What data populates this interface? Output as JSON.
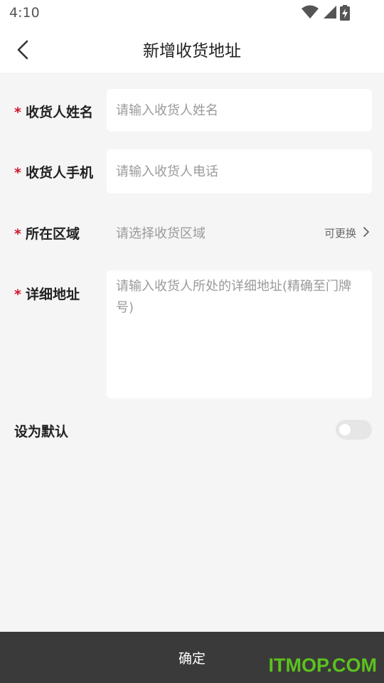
{
  "status_bar": {
    "time": "4:10",
    "icons": [
      "wifi-icon",
      "cellular-signal-icon",
      "battery-charging-icon"
    ]
  },
  "header": {
    "title": "新增收货地址",
    "back_icon": "chevron-left-icon"
  },
  "form": {
    "required_mark": "*",
    "name": {
      "label": "收货人姓名",
      "placeholder": "请输入收货人姓名",
      "value": ""
    },
    "phone": {
      "label": "收货人手机",
      "placeholder": "请输入收货人电话",
      "value": ""
    },
    "region": {
      "label": "所在区域",
      "placeholder": "请选择收货区域",
      "change_label": "可更换",
      "chevron_icon": "chevron-right-icon"
    },
    "address": {
      "label": "详细地址",
      "placeholder": "请输入收货人所处的详细地址(精确至门牌号)",
      "value": ""
    },
    "set_default": {
      "label": "设为默认",
      "checked": false
    }
  },
  "footer": {
    "confirm_label": "确定"
  },
  "watermark": {
    "text": "ITMOP.COM",
    "color": "#5cc21d"
  },
  "colors": {
    "required": "#d0152b",
    "footer_bg": "#3a3a3a",
    "page_bg": "#f5f5f5"
  }
}
